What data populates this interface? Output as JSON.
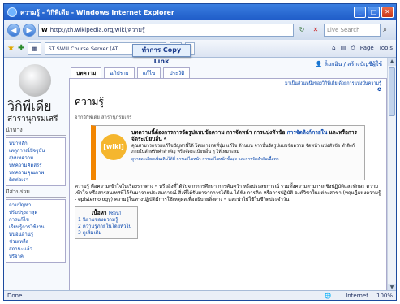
{
  "window": {
    "title": "ความรู้ - วิกิพีเดีย - Windows Internet Explorer"
  },
  "nav": {
    "address": "http://th.wikipedia.org/wiki/ความรู้",
    "search_placeholder": "Live Search",
    "back_icon": "back-arrow-icon",
    "forward_icon": "forward-arrow-icon"
  },
  "fav": {
    "tab_label": "ST SWU Course Server (AT",
    "right_items": [
      "Page",
      "Tools"
    ]
  },
  "callout": "ทำการ Copy Link",
  "wiki": {
    "logo_title": "วิกิพีเดีย",
    "logo_sub": "สารานุกรมเสรี",
    "user_links": "ล็อกอิน / สร้างบัญชีผู้ใช้",
    "tabs": [
      "บทความ",
      "อภิปราย",
      "แก้ไข",
      "ประวัติ"
    ],
    "site_notice": "มาเป็นส่วนหนึ่งของวิกิพีเดีย ด้วยการแบ่งปันความรู้",
    "heading": "ความรู้",
    "from": "จากวิกิพีเดีย สารานุกรมเสรี",
    "notice_badge": "[wiki]",
    "notice_line1": "บทความนี้ต้องการการจัดรูปแบบข้อความ การจัดหน้า การแบ่งหัวข้อ",
    "notice_line1b": "การจัดลิงก์ภายใน",
    "notice_line1c": "และหรือการจัดระเบียบอื่น ๆ",
    "notice_line2": "คุณสามารถช่วยแก้ไขปัญหานี้ได้ โดยการกดที่ปุ่ม แก้ไข ด้านบน จากนั้นจัดรูปแบบข้อความ จัดหน้า แบ่งหัวข้อ ทำลิงก์ภายในสำหรับคำสำคัญ หรือจัดระเบียบอื่น ๆ ให้เหมาะสม",
    "notice_line3": "ดูรายละเอียดเพิ่มเติมได้ที่ การแก้ไขหน้า การแก้ไขหน้าขั้นสูง และการจัดลำดับเนื้อหา",
    "para": "ความรู้ คือความเข้าใจในเรื่องราวต่าง ๆ หรือสิ่งที่ได้รับจากการศึกษา การค้นคว้า หรือประสบการณ์ รวมทั้งความสามารถเชิงปฏิบัติและทักษะ ความเข้าใจ หรือสารสนเทศที่ได้รับมาจากประสบการณ์ สิ่งที่ได้รับมาจากการได้ยิน ได้ฟัง การคิด หรือการปฏิบัติ องค์วิชาในแต่ละสาขา (ทฤษฎีแห่งความรู้ - epistemology) ความรู้ในทางปฏิบัติมีการใช้เหตุผลเพื่ออธิบายสิ่งต่าง ๆ และนำไปใช้ในชีวิตประจำวัน",
    "toc_title": "เนื้อหา",
    "toc_hide": "[ซ่อน]",
    "toc_items": [
      "1 นิยามของความรู้",
      "2 ความรู้ภายในโดยทั่วไป",
      "3 ดูเพิ่มเติม"
    ],
    "portlets": [
      {
        "title": "นำทาง",
        "items": [
          "หน้าหลัก",
          "เหตุการณ์ปัจจุบัน",
          "สุ่มบทความ",
          "บทความคัดสรร",
          "บทความคุณภาพ",
          "ติดต่อเรา"
        ]
      },
      {
        "title": "มีส่วนร่วม",
        "items": [
          "ถามปัญหา",
          "ปรับปรุงล่าสุด",
          "การแก้ไข",
          "เรียนรู้การใช้งาน",
          "หนอนอ่านรู้",
          "ช่วยเหลือ",
          "สถานะแล้ว",
          "บริจาค"
        ]
      }
    ]
  },
  "status": {
    "left": "Done",
    "zone": "Internet",
    "zoom": "100%"
  }
}
